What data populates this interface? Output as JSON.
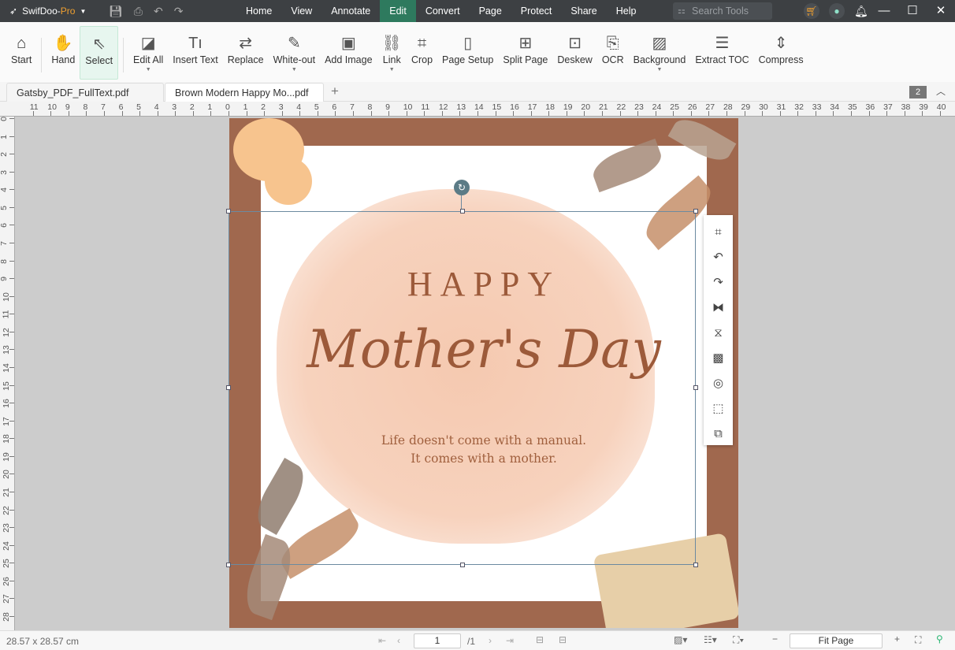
{
  "app": {
    "name": "SwifDoo-",
    "edition": "Pro"
  },
  "menus": [
    "Home",
    "View",
    "Annotate",
    "Edit",
    "Convert",
    "Page",
    "Protect",
    "Share",
    "Help"
  ],
  "active_menu": "Edit",
  "search": {
    "placeholder": "Search Tools"
  },
  "toolbar": [
    {
      "label": "Start",
      "icon": "home-icon",
      "glyph": "⌂"
    },
    {
      "label": "Hand",
      "icon": "hand-icon",
      "glyph": "✋"
    },
    {
      "label": "Select",
      "icon": "cursor-icon",
      "glyph": "⇖",
      "selected": true
    },
    {
      "label": "Edit All",
      "icon": "edit-icon",
      "glyph": "◪",
      "dropdown": true
    },
    {
      "label": "Insert Text",
      "icon": "text-icon",
      "glyph": "Tı"
    },
    {
      "label": "Replace",
      "icon": "replace-icon",
      "glyph": "⇄"
    },
    {
      "label": "White-out",
      "icon": "eraser-icon",
      "glyph": "✎",
      "dropdown": true
    },
    {
      "label": "Add Image",
      "icon": "image-icon",
      "glyph": "▣"
    },
    {
      "label": "Link",
      "icon": "link-icon",
      "glyph": "⛓",
      "dropdown": true
    },
    {
      "label": "Crop",
      "icon": "crop-icon",
      "glyph": "⌗"
    },
    {
      "label": "Page Setup",
      "icon": "page-setup-icon",
      "glyph": "▯"
    },
    {
      "label": "Split Page",
      "icon": "split-page-icon",
      "glyph": "⊞"
    },
    {
      "label": "Deskew",
      "icon": "deskew-icon",
      "glyph": "⊡"
    },
    {
      "label": "OCR",
      "icon": "ocr-icon",
      "glyph": "⎘"
    },
    {
      "label": "Background",
      "icon": "background-icon",
      "glyph": "▨",
      "dropdown": true
    },
    {
      "label": "Extract TOC",
      "icon": "extract-toc-icon",
      "glyph": "☰"
    },
    {
      "label": "Compress",
      "icon": "compress-icon",
      "glyph": "⇕"
    }
  ],
  "tabs": [
    {
      "label": "Gatsby_PDF_FullText.pdf"
    },
    {
      "label": "Brown Modern Happy Mo...pdf",
      "active": true,
      "modified": true
    }
  ],
  "tab_count": "2",
  "ruler": {
    "h": [
      "11",
      "10",
      "9",
      "8",
      "7",
      "6",
      "5",
      "4",
      "3",
      "2",
      "1",
      "0",
      "1",
      "2",
      "3",
      "4",
      "5",
      "6",
      "7",
      "8",
      "9",
      "10",
      "11",
      "12",
      "13",
      "14",
      "15",
      "16",
      "17",
      "18",
      "19",
      "20",
      "21",
      "22",
      "23",
      "24",
      "25",
      "26",
      "27",
      "28",
      "29",
      "30",
      "31",
      "32",
      "33",
      "34",
      "35",
      "36",
      "37",
      "38",
      "39",
      "40"
    ],
    "v": [
      "0",
      "1",
      "2",
      "3",
      "4",
      "5",
      "6",
      "7",
      "8",
      "9",
      "10",
      "11",
      "12",
      "13",
      "14",
      "15",
      "16",
      "17",
      "18",
      "19",
      "20",
      "21",
      "22",
      "23",
      "24",
      "25",
      "26",
      "27",
      "28"
    ]
  },
  "document": {
    "heading": "HAPPY",
    "title": "Mother's Day",
    "line1": "Life doesn't come with a manual.",
    "line2": "It comes with a mother."
  },
  "float_tools": [
    "crop-icon",
    "rotate-left-icon",
    "rotate-right-icon",
    "flip-horizontal-icon",
    "flip-vertical-icon",
    "replace-image-icon",
    "opacity-icon",
    "fit-icon",
    "extract-image-icon"
  ],
  "status": {
    "size": "28.57 x 28.57 cm",
    "page": "1",
    "total": "/1",
    "zoom": "Fit Page"
  },
  "colors": {
    "accent": "#2e7a5e",
    "page_bg": "#a0684e",
    "text": "#9c5a3a"
  }
}
